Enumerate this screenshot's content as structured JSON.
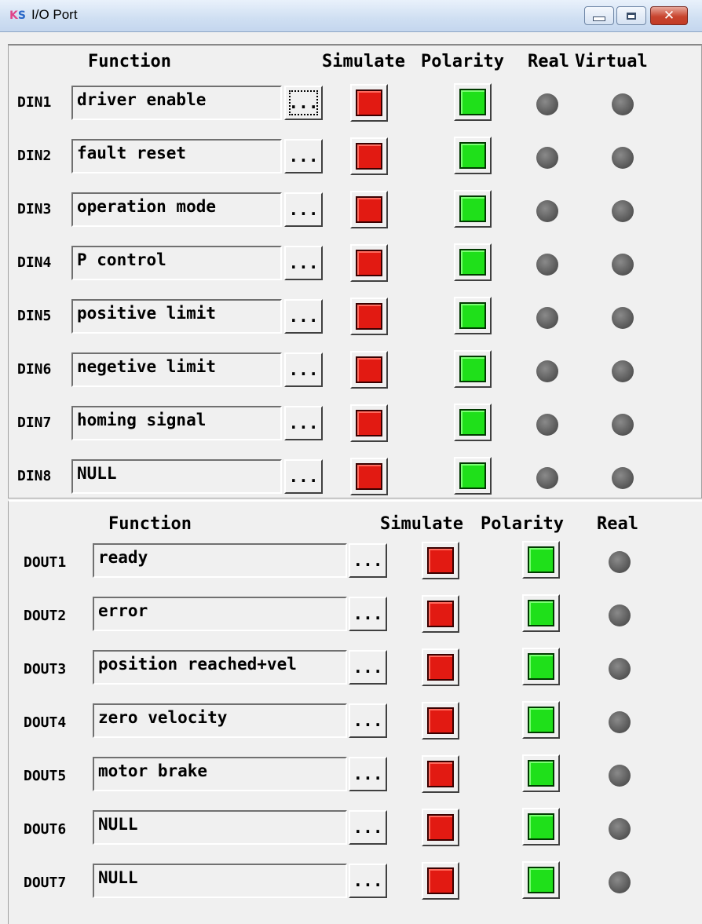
{
  "window": {
    "title": "I/O Port",
    "icon": "ks-app-icon",
    "close_glyph": "✕"
  },
  "din": {
    "headers": {
      "function": "Function",
      "simulate": "Simulate",
      "polarity": "Polarity",
      "real": "Real",
      "virtual": "Virtual"
    },
    "button_label": "...",
    "rows": [
      {
        "label": "DIN1",
        "function": "driver enable"
      },
      {
        "label": "DIN2",
        "function": "fault reset"
      },
      {
        "label": "DIN3",
        "function": "operation mode"
      },
      {
        "label": "DIN4",
        "function": "P control"
      },
      {
        "label": "DIN5",
        "function": "positive limit"
      },
      {
        "label": "DIN6",
        "function": "negetive limit"
      },
      {
        "label": "DIN7",
        "function": "homing signal"
      },
      {
        "label": "DIN8",
        "function": "NULL"
      }
    ]
  },
  "dout": {
    "headers": {
      "function": "Function",
      "simulate": "Simulate",
      "polarity": "Polarity",
      "real": "Real"
    },
    "button_label": "...",
    "rows": [
      {
        "label": "DOUT1",
        "function": "ready"
      },
      {
        "label": "DOUT2",
        "function": "error"
      },
      {
        "label": "DOUT3",
        "function": "position reached+vel"
      },
      {
        "label": "DOUT4",
        "function": "zero velocity"
      },
      {
        "label": "DOUT5",
        "function": "motor brake"
      },
      {
        "label": "DOUT6",
        "function": "NULL"
      },
      {
        "label": "DOUT7",
        "function": "NULL"
      }
    ]
  },
  "colors": {
    "simulate": "#e21a12",
    "polarity": "#1fe01a",
    "indicator_off": "#555555"
  }
}
